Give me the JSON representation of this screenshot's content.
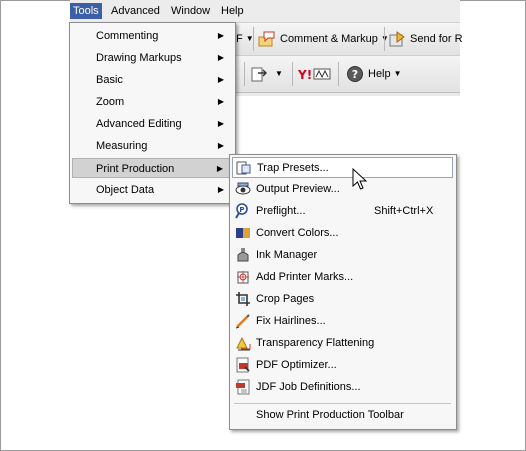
{
  "menubar": {
    "items": [
      {
        "label": "Tools",
        "active": true
      },
      {
        "label": "Advanced"
      },
      {
        "label": "Window"
      },
      {
        "label": "Help"
      }
    ]
  },
  "toolbar": {
    "comment_markup_label": "Comment & Markup",
    "send_label": "Send for R",
    "help_label": "Help",
    "partial_char": "F"
  },
  "tools_menu": {
    "items": [
      {
        "label": "Commenting",
        "submenu": true
      },
      {
        "label": "Drawing Markups",
        "submenu": true
      },
      {
        "label": "Basic",
        "submenu": true
      },
      {
        "label": "Zoom",
        "submenu": true
      },
      {
        "label": "Advanced Editing",
        "submenu": true
      },
      {
        "label": "Measuring",
        "submenu": true
      },
      {
        "label": "Print Production",
        "submenu": true,
        "highlighted": true
      },
      {
        "label": "Object Data",
        "submenu": true
      }
    ]
  },
  "print_production_menu": {
    "items": [
      {
        "label": "Trap Presets...",
        "icon": "trap-presets-icon",
        "highlighted": true
      },
      {
        "label": "Output Preview...",
        "icon": "output-preview-icon"
      },
      {
        "label": "Preflight...",
        "icon": "preflight-icon",
        "shortcut": "Shift+Ctrl+X"
      },
      {
        "label": "Convert Colors...",
        "icon": "convert-colors-icon"
      },
      {
        "label": "Ink Manager",
        "icon": "ink-manager-icon"
      },
      {
        "label": "Add Printer Marks...",
        "icon": "printer-marks-icon"
      },
      {
        "label": "Crop Pages",
        "icon": "crop-pages-icon"
      },
      {
        "label": "Fix Hairlines...",
        "icon": "fix-hairlines-icon"
      },
      {
        "label": "Transparency Flattening",
        "icon": "transparency-flattening-icon"
      },
      {
        "label": "PDF Optimizer...",
        "icon": "pdf-optimizer-icon"
      },
      {
        "label": "JDF Job Definitions...",
        "icon": "jdf-job-icon"
      }
    ],
    "footer_label": "Show Print Production Toolbar"
  },
  "colors": {
    "menu_active": "#3d5fa8",
    "menu_bg": "#f7f7f7",
    "highlight": "#d2d2d2"
  }
}
